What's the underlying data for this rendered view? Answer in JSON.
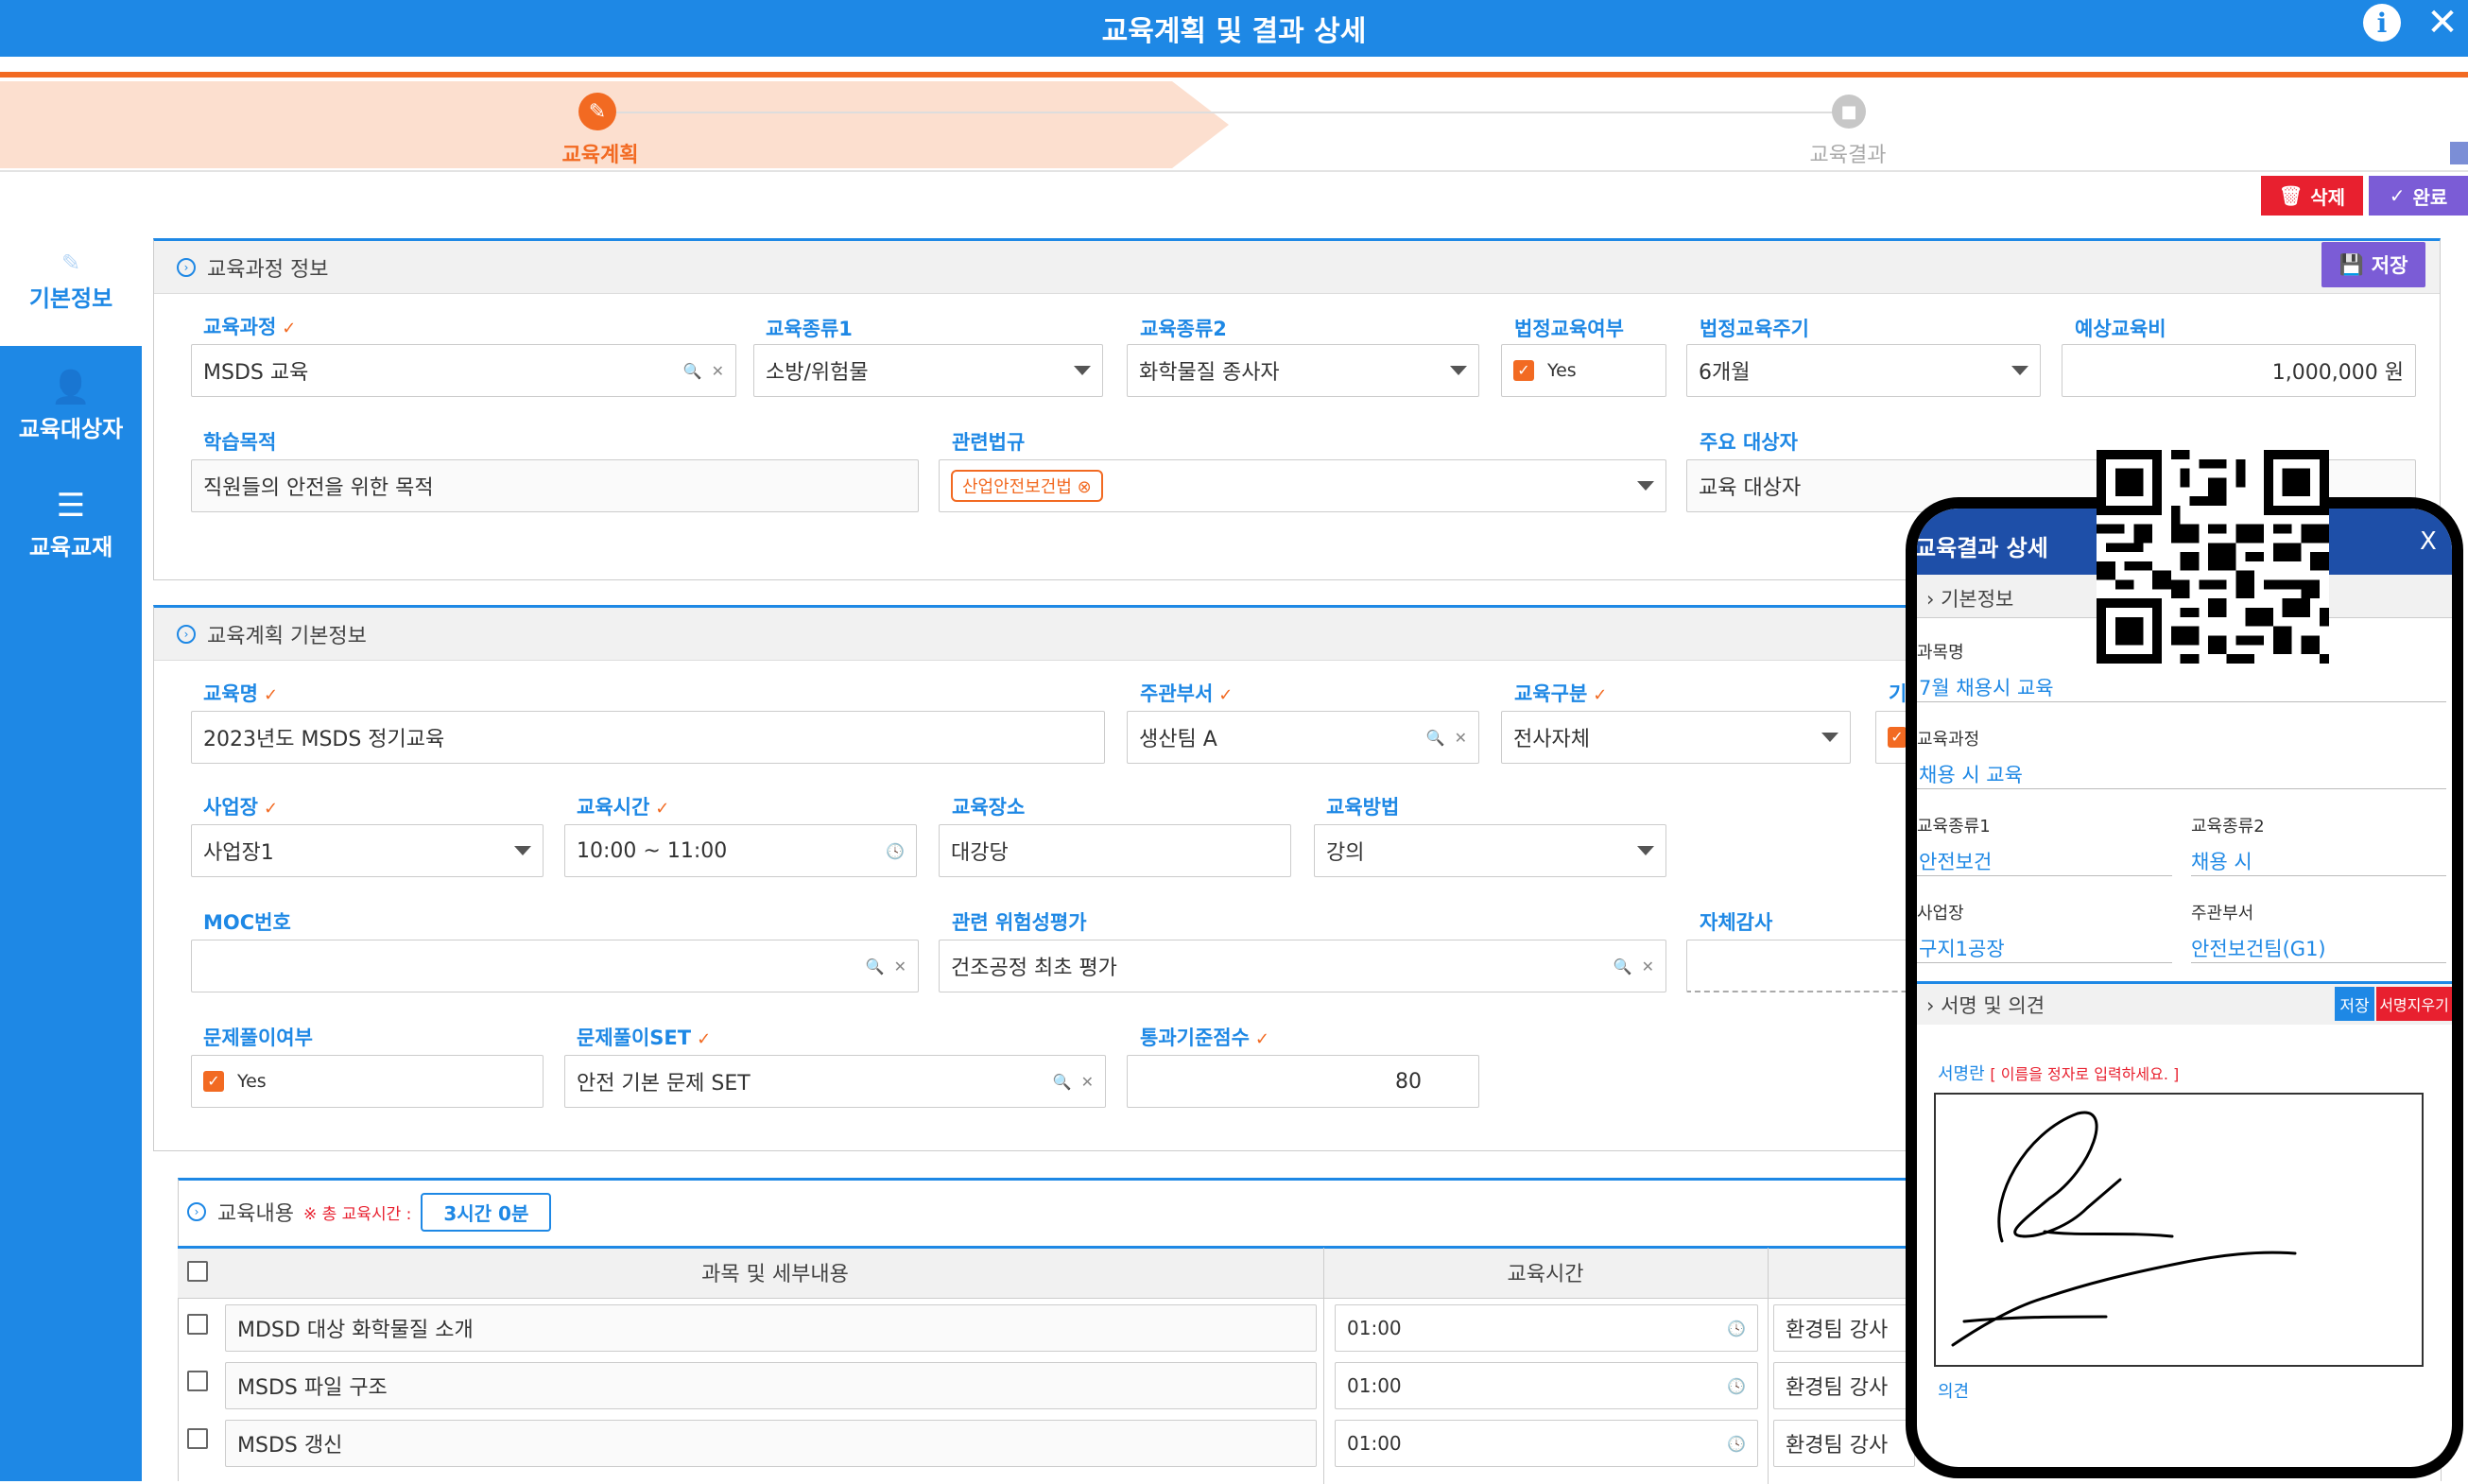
{
  "window": {
    "title": "교육계획 및 결과 상세",
    "info_icon": "i",
    "close_icon": "✕"
  },
  "steps": [
    {
      "label": "교육계획",
      "icon": "pencil-icon",
      "active": true
    },
    {
      "label": "교육결과",
      "icon": "stop-icon",
      "active": false
    }
  ],
  "toolbar": {
    "delete_label": "삭제",
    "complete_label": "완료"
  },
  "sidebar": {
    "items": [
      {
        "label": "기본정보",
        "icon": "pencil-icon"
      },
      {
        "label": "교육대상자",
        "icon": "user-check-icon"
      },
      {
        "label": "교육교재",
        "icon": "checklist-icon"
      }
    ]
  },
  "course_info": {
    "title": "교육과정 정보",
    "save_label": "저장",
    "fields": {
      "course": {
        "label": "교육과정",
        "value": "MSDS 교육"
      },
      "type1": {
        "label": "교육종류1",
        "value": "소방/위험물"
      },
      "type2": {
        "label": "교육종류2",
        "value": "화학물질 종사자"
      },
      "legal": {
        "label": "법정교육여부",
        "value": "Yes"
      },
      "legal_cycle": {
        "label": "법정교육주기",
        "value": "6개월"
      },
      "cost": {
        "label": "예상교육비",
        "value": "1,000,000 원"
      },
      "purpose": {
        "label": "학습목적",
        "value": "직원들의 안전을 위한 목적"
      },
      "law": {
        "label": "관련법규",
        "tag": "산업안전보건법"
      },
      "target": {
        "label": "주요 대상자",
        "value": "교육 대상자"
      }
    }
  },
  "plan_info": {
    "title": "교육계획 기본정보",
    "fields": {
      "name": {
        "label": "교육명",
        "value": "2023년도 MSDS 정기교육"
      },
      "dept": {
        "label": "주관부서",
        "value": "생산팀 A"
      },
      "category": {
        "label": "교육구분",
        "value": "전사자체"
      },
      "extra_label": "기",
      "site": {
        "label": "사업장",
        "value": "사업장1"
      },
      "time": {
        "label": "교육시간",
        "value": "10:00 ~ 11:00"
      },
      "place": {
        "label": "교육장소",
        "value": "대강당"
      },
      "method": {
        "label": "교육방법",
        "value": "강의"
      },
      "moc": {
        "label": "MOC번호",
        "value": ""
      },
      "risk": {
        "label": "관련 위험성평가",
        "value": "건조공정 최초 평가"
      },
      "audit": {
        "label": "자체감사",
        "value": ""
      },
      "quiz": {
        "label": "문제풀이여부",
        "value": "Yes"
      },
      "quiz_set": {
        "label": "문제풀이SET",
        "value": "안전 기본 문제 SET"
      },
      "pass_score": {
        "label": "통과기준점수",
        "value": "80"
      }
    }
  },
  "contents": {
    "title": "교육내용",
    "total_note": "※ 총 교육시간 :",
    "total_value": "3시간 0분",
    "headers": [
      "과목 및 세부내용",
      "교육시간"
    ],
    "rows": [
      {
        "subject": "MDSD 대상 화학물질 소개",
        "time": "01:00",
        "instructor": "환경팀 강사"
      },
      {
        "subject": "MSDS 파일 구조",
        "time": "01:00",
        "instructor": "환경팀 강사"
      },
      {
        "subject": "MSDS 갱신",
        "time": "01:00",
        "instructor": "환경팀 강사"
      }
    ]
  },
  "mobile": {
    "title": "교육결과 상세",
    "close": "X",
    "section1": "기본정보",
    "subject_label": "과목명",
    "subject_value": "7월 채용시 교육",
    "course_label": "교육과정",
    "course_value": "채용 시 교육",
    "type1_label": "교육종류1",
    "type1_value": "안전보건",
    "type2_label": "교육종류2",
    "type2_value": "채용 시",
    "site_label": "사업장",
    "site_value": "구지1공장",
    "dept_label": "주관부서",
    "dept_value": "안전보건팀(G1)",
    "section2": "서명 및 의견",
    "save_label": "저장",
    "clear_label": "서명지우기",
    "sign_label": "서명란",
    "sign_hint": "[ 이름을 정자로 입력하세요. ]",
    "opinion_label": "의견"
  },
  "colors": {
    "primary": "#1e88e5",
    "accent": "#f26a22",
    "purple": "#7b5cd6",
    "danger": "#e8202f"
  }
}
